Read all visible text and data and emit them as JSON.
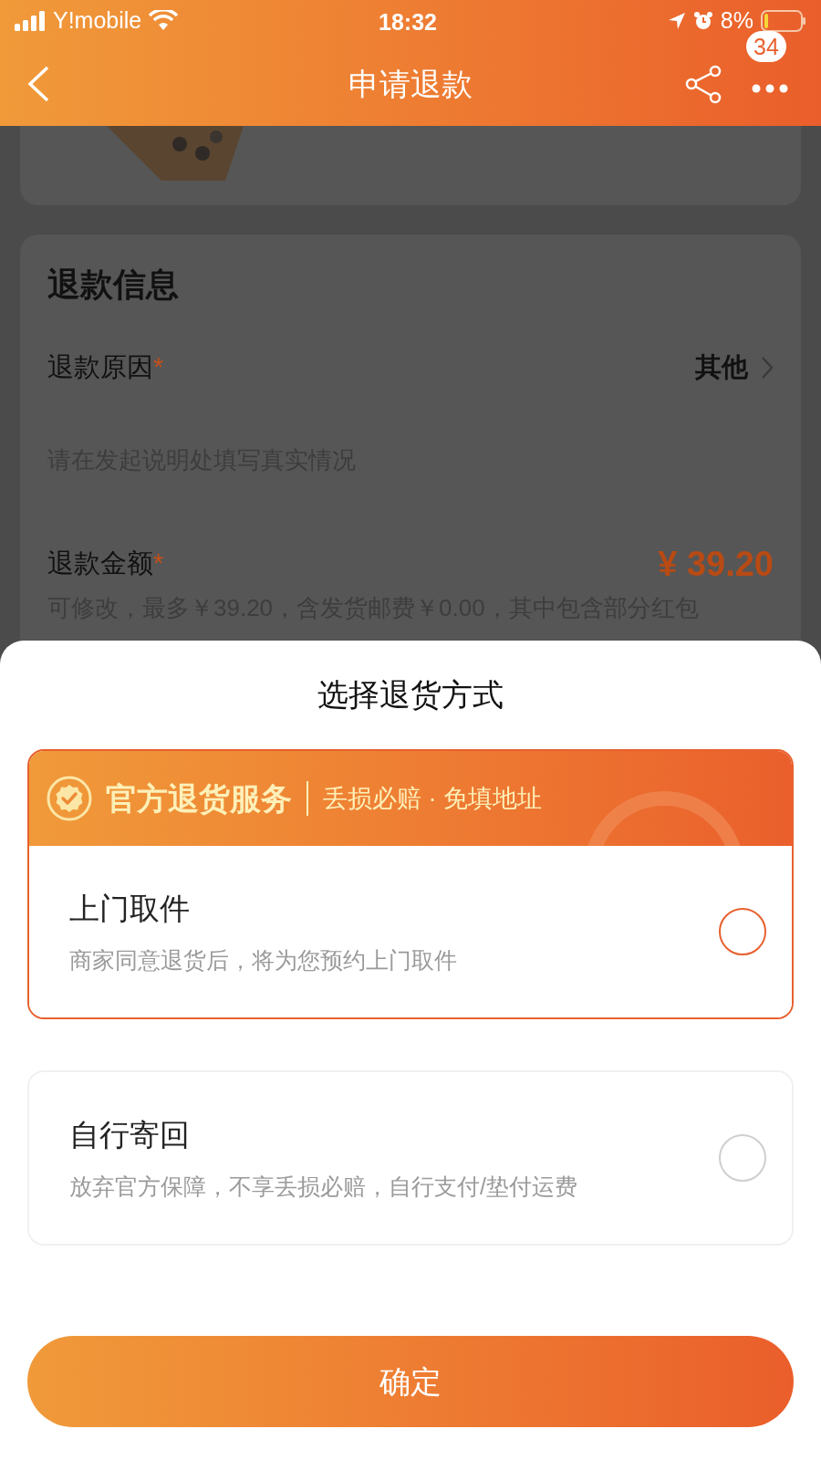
{
  "status_bar": {
    "carrier": "Y!mobile",
    "time": "18:32",
    "battery": "8%"
  },
  "nav": {
    "title": "申请退款",
    "badge": "34"
  },
  "refund_info": {
    "title": "退款信息",
    "reason_label": "退款原因",
    "required_mark": "*",
    "reason_value": "其他",
    "reason_hint": "请在发起说明处填写真实情况",
    "amount_label": "退款金额",
    "amount_required_mark": "*",
    "amount": "¥ 39.20",
    "amount_note": "可修改，最多￥39.20，含发货邮费￥0.00，其中包含部分红包"
  },
  "sheet": {
    "title": "选择退货方式",
    "methods": [
      {
        "kind": "official",
        "banner_title": "官方退货服务",
        "banner_tagline": "丢损必赔 · 免填地址",
        "title": "上门取件",
        "description": "商家同意退货后，将为您预约上门取件",
        "selected": true
      },
      {
        "kind": "plain",
        "title": "自行寄回",
        "description": "放弃官方保障，不享丢损必赔，自行支付/垫付运费",
        "selected": false
      }
    ],
    "confirm": "确定"
  }
}
